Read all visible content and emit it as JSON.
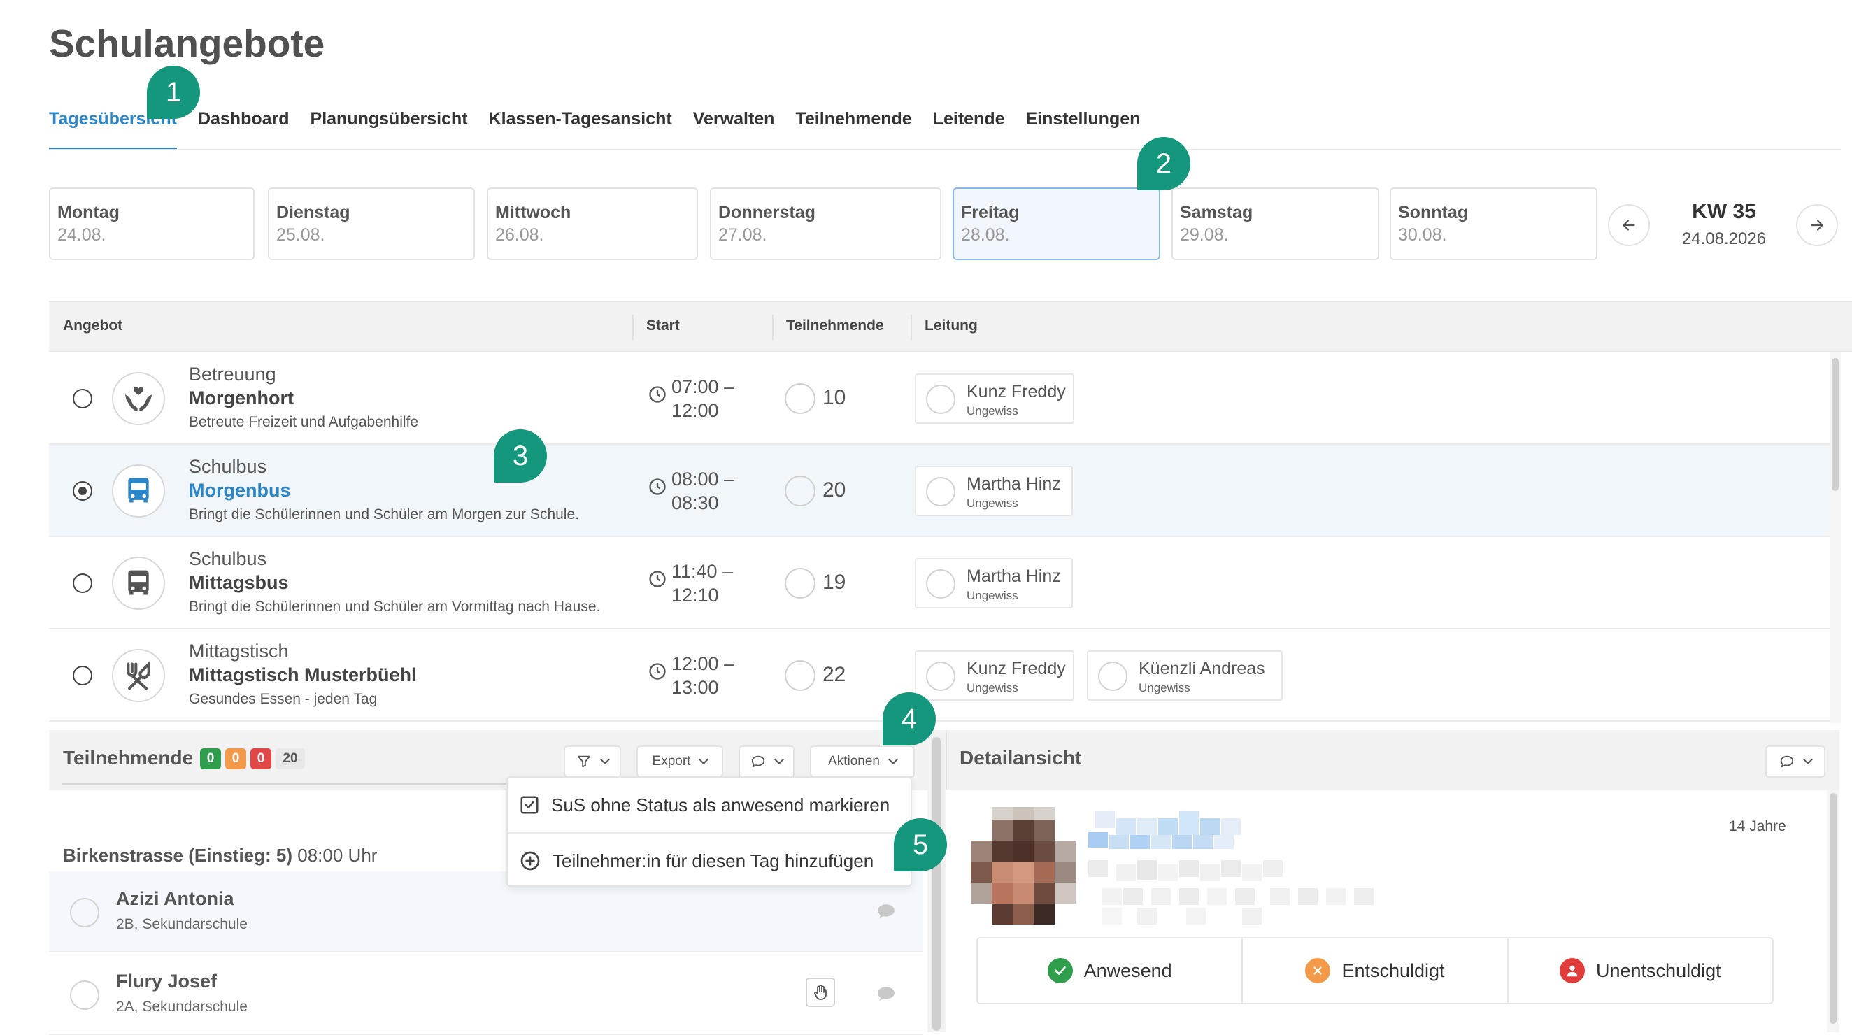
{
  "page": {
    "title": "Schulangebote"
  },
  "tabs": [
    {
      "label": "Tagesübersicht",
      "active": true
    },
    {
      "label": "Dashboard"
    },
    {
      "label": "Planungsübersicht"
    },
    {
      "label": "Klassen-Tagesansicht"
    },
    {
      "label": "Verwalten"
    },
    {
      "label": "Teilnehmende"
    },
    {
      "label": "Leitende"
    },
    {
      "label": "Einstellungen"
    }
  ],
  "badges": [
    "1",
    "2",
    "3",
    "4",
    "5"
  ],
  "days": [
    {
      "name": "Montag",
      "date": "24.08."
    },
    {
      "name": "Dienstag",
      "date": "25.08."
    },
    {
      "name": "Mittwoch",
      "date": "26.08."
    },
    {
      "name": "Donnerstag",
      "date": "27.08."
    },
    {
      "name": "Freitag",
      "date": "28.08.",
      "active": true
    },
    {
      "name": "Samstag",
      "date": "29.08."
    },
    {
      "name": "Sonntag",
      "date": "30.08."
    }
  ],
  "week": {
    "label": "KW 35",
    "date": "24.08.2026"
  },
  "offers_table": {
    "columns": [
      "Angebot",
      "Start",
      "Teilnehmende",
      "Leitung"
    ],
    "rows": [
      {
        "category": "Betreuung",
        "name": "Morgenhort",
        "description": "Betreute Freizeit und Aufgabenhilfe",
        "time_start": "07:00 –",
        "time_end": "12:00",
        "participants": "10",
        "icon": "care-hands-icon",
        "leaders": [
          {
            "name": "Kunz Freddy",
            "status": "Ungewiss"
          }
        ]
      },
      {
        "category": "Schulbus",
        "name": "Morgenbus",
        "description": "Bringt die Schülerinnen und Schüler am Morgen zur Schule.",
        "time_start": "08:00 –",
        "time_end": "08:30",
        "participants": "20",
        "icon": "bus-icon",
        "selected": true,
        "leaders": [
          {
            "name": "Martha Hinz",
            "status": "Ungewiss"
          }
        ]
      },
      {
        "category": "Schulbus",
        "name": "Mittagsbus",
        "description": "Bringt die Schülerinnen und Schüler am Vormittag nach Hause.",
        "time_start": "11:40 –",
        "time_end": "12:10",
        "participants": "19",
        "icon": "bus-icon",
        "leaders": [
          {
            "name": "Martha Hinz",
            "status": "Ungewiss"
          }
        ]
      },
      {
        "category": "Mittagstisch",
        "name": "Mittagstisch Musterbüehl",
        "description": "Gesundes Essen - jeden Tag",
        "time_start": "12:00 –",
        "time_end": "13:00",
        "participants": "22",
        "icon": "cutlery-icon",
        "leaders": [
          {
            "name": "Kunz Freddy",
            "status": "Ungewiss"
          },
          {
            "name": "Küenzli Andreas",
            "status": "Ungewiss"
          }
        ]
      }
    ]
  },
  "participants_panel": {
    "title": "Teilnehmende",
    "counts": [
      {
        "value": "0",
        "color": "#2e9e4c"
      },
      {
        "value": "0",
        "color": "#f2994a"
      },
      {
        "value": "0",
        "color": "#e04848"
      },
      {
        "value": "20",
        "color": "#e8e8e8"
      }
    ],
    "export_label": "Export",
    "actions_label": "Aktionen",
    "actions_menu": [
      "SuS ohne Status als anwesend markieren",
      "Teilnehmer:in für diesen Tag hinzufügen"
    ],
    "group": {
      "name": "Birkenstrasse (Einstieg: 5)",
      "time": "08:00 Uhr"
    },
    "people": [
      {
        "name": "Azizi Antonia",
        "class": "2B, Sekundarschule"
      },
      {
        "name": "Flury Josef",
        "class": "2A, Sekundarschule"
      }
    ]
  },
  "detail_panel": {
    "title": "Detailansicht",
    "age": "14 Jahre",
    "status_options": [
      {
        "label": "Anwesend",
        "color": "#2e9e4c",
        "icon": "check-icon"
      },
      {
        "label": "Entschuldigt",
        "color": "#f2994a",
        "icon": "x-icon"
      },
      {
        "label": "Unentschuldigt",
        "color": "#e03c3c",
        "icon": "person-icon"
      }
    ]
  }
}
